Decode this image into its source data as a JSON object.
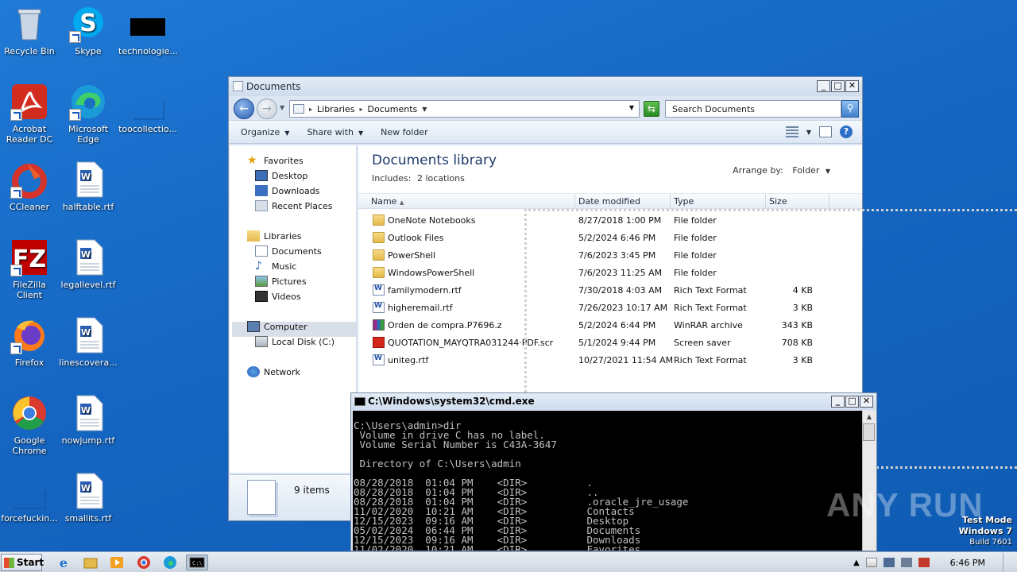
{
  "desktop": {
    "icons": [
      {
        "label": "Recycle Bin"
      },
      {
        "label": "Skype"
      },
      {
        "label": "technologie..."
      },
      {
        "label": "Acrobat Reader DC"
      },
      {
        "label": "Microsoft Edge"
      },
      {
        "label": "toocollectio..."
      },
      {
        "label": "CCleaner"
      },
      {
        "label": "halftable.rtf"
      },
      {
        "label": "FileZilla Client"
      },
      {
        "label": "legallevel.rtf"
      },
      {
        "label": "Firefox"
      },
      {
        "label": "linescovera..."
      },
      {
        "label": "Google Chrome"
      },
      {
        "label": "nowjump.rtf"
      },
      {
        "label": "forcefuckin..."
      },
      {
        "label": "smallits.rtf"
      }
    ]
  },
  "explorer": {
    "title": "Documents",
    "address": {
      "crumbs": [
        "Libraries",
        "Documents"
      ]
    },
    "search_placeholder": "Search Documents",
    "toolbar": {
      "organize": "Organize",
      "share_with": "Share with",
      "new_folder": "New folder"
    },
    "nav": {
      "favorites": "Favorites",
      "desktop": "Desktop",
      "downloads": "Downloads",
      "recent": "Recent Places",
      "libraries": "Libraries",
      "documents": "Documents",
      "music": "Music",
      "pictures": "Pictures",
      "videos": "Videos",
      "computer": "Computer",
      "local_disk": "Local Disk (C:)",
      "network": "Network"
    },
    "library": {
      "title": "Documents library",
      "includes_label": "Includes:",
      "includes_link": "2 locations",
      "arrange_label": "Arrange by:",
      "arrange_value": "Folder"
    },
    "columns": {
      "name": "Name",
      "date": "Date modified",
      "type": "Type",
      "size": "Size"
    },
    "files": [
      {
        "name": "OneNote Notebooks",
        "date": "8/27/2018 1:00 PM",
        "type": "File folder",
        "size": "",
        "icon": "folder-icon"
      },
      {
        "name": "Outlook Files",
        "date": "5/2/2024 6:46 PM",
        "type": "File folder",
        "size": "",
        "icon": "folder-icon"
      },
      {
        "name": "PowerShell",
        "date": "7/6/2023 3:45 PM",
        "type": "File folder",
        "size": "",
        "icon": "folder-icon"
      },
      {
        "name": "WindowsPowerShell",
        "date": "7/6/2023 11:25 AM",
        "type": "File folder",
        "size": "",
        "icon": "folder-icon"
      },
      {
        "name": "familymodern.rtf",
        "date": "7/30/2018 4:03 AM",
        "type": "Rich Text Format",
        "size": "4 KB",
        "icon": "rtf-icon"
      },
      {
        "name": "higheremail.rtf",
        "date": "7/26/2023 10:17 AM",
        "type": "Rich Text Format",
        "size": "3 KB",
        "icon": "rtf-icon"
      },
      {
        "name": "Orden de compra.P7696.z",
        "date": "5/2/2024 6:44 PM",
        "type": "WinRAR archive",
        "size": "343 KB",
        "icon": "rar-icon"
      },
      {
        "name": "QUOTATION_MAYQTRA031244·PDF.scr",
        "date": "5/1/2024 9:44 PM",
        "type": "Screen saver",
        "size": "708 KB",
        "icon": "pdf-icon"
      },
      {
        "name": "uniteg.rtf",
        "date": "10/27/2021 11:54 AM",
        "type": "Rich Text Format",
        "size": "3 KB",
        "icon": "rtf-icon"
      }
    ],
    "status": {
      "items": "9 items"
    }
  },
  "cmd": {
    "title": "C:\\Windows\\system32\\cmd.exe",
    "output": "C:\\Users\\admin>dir\n Volume in drive C has no label.\n Volume Serial Number is C43A-3647\n\n Directory of C:\\Users\\admin\n\n08/28/2018  01:04 PM    <DIR>          .\n08/28/2018  01:04 PM    <DIR>          ..\n08/28/2018  01:04 PM    <DIR>          .oracle_jre_usage\n11/02/2020  10:21 AM    <DIR>          Contacts\n12/15/2023  09:16 AM    <DIR>          Desktop\n05/02/2024  06:44 PM    <DIR>          Documents\n12/15/2023  09:16 AM    <DIR>          Downloads\n11/02/2020  10:21 AM    <DIR>          Favorites"
  },
  "watermark": "ANY RUN",
  "testmode": {
    "line1": "Test Mode",
    "line2": "Windows 7",
    "line3": "Build 7601"
  },
  "taskbar": {
    "start": "Start",
    "clock": "6:46 PM"
  }
}
